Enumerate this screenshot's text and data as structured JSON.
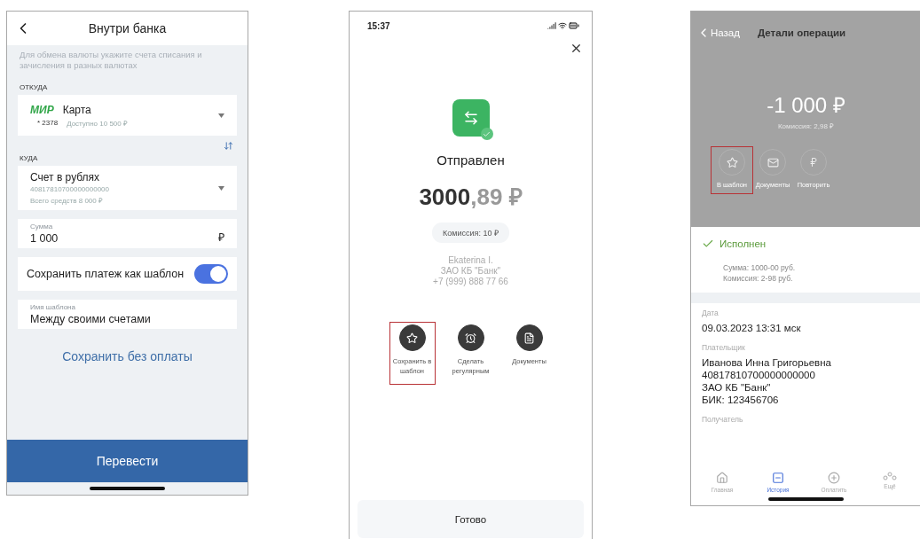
{
  "transfer_form": {
    "title": "Внутри банка",
    "hint": "Для обмена валюты укажите счета списания и зачисления в разных валютах",
    "from": {
      "label": "ОТКУДА",
      "logo": "МИР",
      "name": "Карта",
      "number": "* 2378",
      "available": "Доступно 10 500 ₽"
    },
    "to": {
      "label": "КУДА",
      "name": "Счет в рублях",
      "account": "40817810700000000000",
      "balance": "Всего средств 8 000 ₽"
    },
    "amount": {
      "placeholder": "Сумма",
      "value": "1 000",
      "currency": "₽"
    },
    "save_template": {
      "label": "Сохранить платеж как шаблон",
      "on": true
    },
    "template_name": {
      "placeholder": "Имя шаблона",
      "value": "Между своими счетами"
    },
    "save_link": "Сохранить без оплаты",
    "submit": "Перевести"
  },
  "success_screen": {
    "time": "15:37",
    "status": "Отправлен",
    "amount_whole": "3000",
    "amount_fraction": ",89 ₽",
    "commission": "Комиссия: 10 ₽",
    "recipient": [
      "Ekaterina I.",
      "ЗАО КБ \"Банк\"",
      "+7 (999) 888 77 66"
    ],
    "actions": [
      {
        "kind": "star",
        "label": "Сохранить в шаблон",
        "highlighted": true
      },
      {
        "kind": "alarm",
        "label": "Сделать регулярным",
        "highlighted": false
      },
      {
        "kind": "document",
        "label": "Документы",
        "highlighted": false
      }
    ],
    "done": "Готово"
  },
  "details_screen": {
    "back": "Назад",
    "title": "Детали операции",
    "amount": "-1 000 ₽",
    "commission": "Комиссия: 2,98 ₽",
    "actions": [
      {
        "kind": "star",
        "label": "В шаблон",
        "highlighted": true
      },
      {
        "kind": "mail",
        "label": "Документы",
        "highlighted": false
      },
      {
        "kind": "repeat",
        "label": "Повторить",
        "highlighted": false
      }
    ],
    "status": "Исполнен",
    "summary": [
      "Сумма: 1000-00 руб.",
      "Комиссия: 2-98 руб."
    ],
    "fields": [
      {
        "label": "Дата",
        "lines": [
          "09.03.2023 13:31 мск"
        ]
      },
      {
        "label": "Плательщик",
        "lines": [
          "Иванова Инна Григорьевна",
          "40817810700000000000",
          "ЗАО КБ \"Банк\"",
          "БИК: 123456706"
        ]
      },
      {
        "label": "Получатель"
      }
    ],
    "tabs": [
      {
        "kind": "home",
        "label": "Главная",
        "selected": false
      },
      {
        "kind": "history",
        "label": "История",
        "selected": true
      },
      {
        "kind": "pay",
        "label": "Оплатить",
        "selected": false
      },
      {
        "kind": "more",
        "label": "Ещё",
        "selected": false
      }
    ]
  }
}
